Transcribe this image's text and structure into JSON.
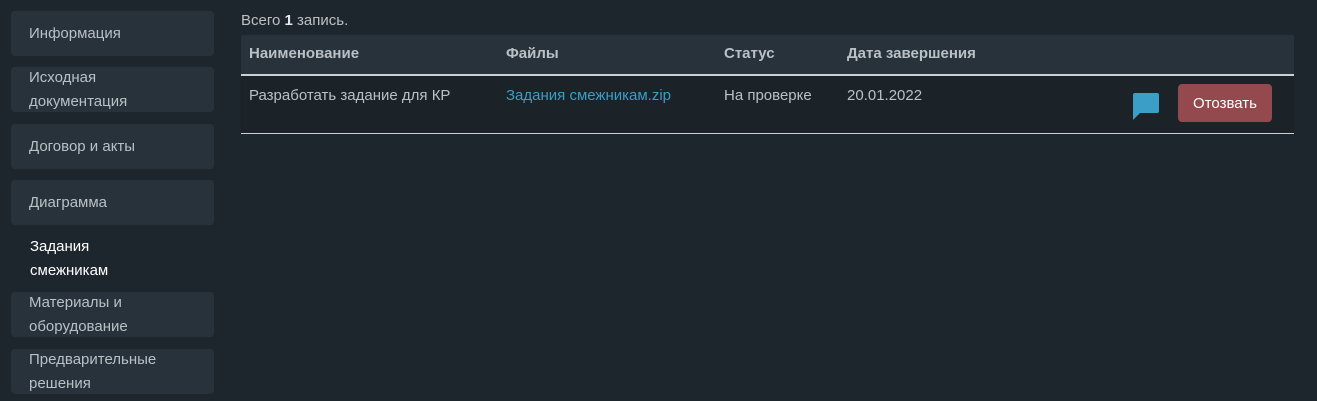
{
  "sidebar": {
    "items": [
      {
        "label": "Информация"
      },
      {
        "label": "Исходная документация"
      },
      {
        "label": "Договор и акты"
      },
      {
        "label": "Диаграмма"
      },
      {
        "label": "Задания смежникам"
      },
      {
        "label": "Материалы и оборудование"
      },
      {
        "label": "Предварительные решения"
      }
    ],
    "active_item": "Задания смежникам"
  },
  "summary": {
    "prefix": "Всего",
    "count": "1",
    "suffix": "запись."
  },
  "table": {
    "headers": [
      "Наименование",
      "Файлы",
      "Статус",
      "Дата завершения"
    ],
    "rows": [
      {
        "name": "Разработать задание для КР",
        "file": "Задания смежникам.zip",
        "status": "На проверке",
        "date": "20.01.2022",
        "comment_icon": "chat-bubble-icon",
        "action_label": "Отозвать"
      }
    ]
  },
  "colors": {
    "background": "#1e262d",
    "panel": "#27323a",
    "link": "#3a9ec7",
    "danger_button": "#94494e",
    "icon": "#3a9ec7"
  }
}
